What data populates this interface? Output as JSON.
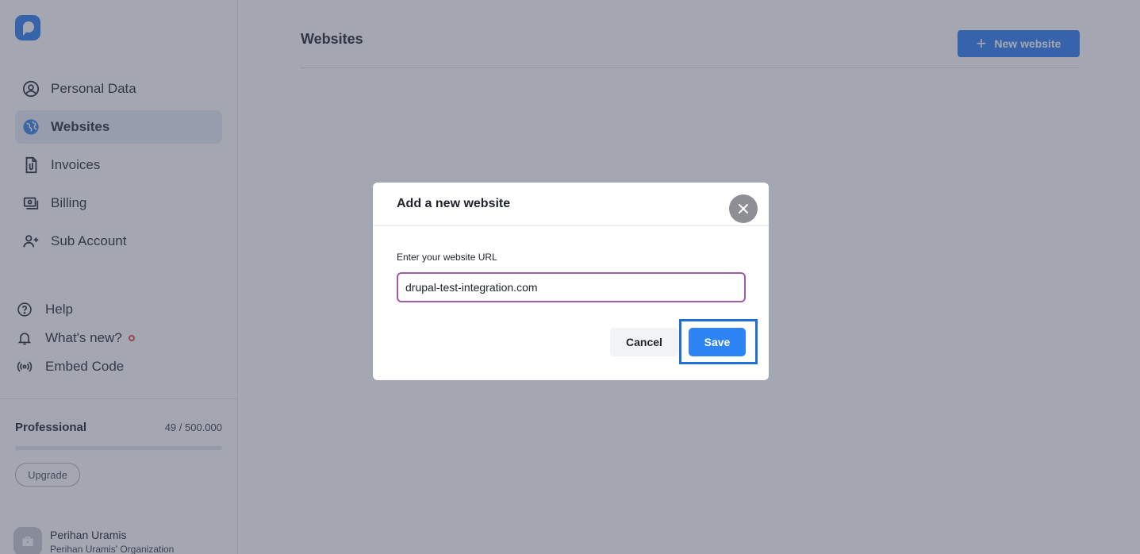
{
  "sidebar": {
    "nav": [
      {
        "label": "Personal Data",
        "icon": "user-circle-icon",
        "active": false
      },
      {
        "label": "Websites",
        "icon": "globe-icon",
        "active": true
      },
      {
        "label": "Invoices",
        "icon": "invoice-icon",
        "active": false
      },
      {
        "label": "Billing",
        "icon": "billing-icon",
        "active": false
      },
      {
        "label": "Sub Account",
        "icon": "add-user-icon",
        "active": false
      }
    ],
    "links": [
      {
        "label": "Help",
        "icon": "help-icon"
      },
      {
        "label": "What's new?",
        "icon": "bell-icon"
      },
      {
        "label": "Embed Code",
        "icon": "broadcast-icon"
      }
    ],
    "plan": {
      "name": "Professional",
      "usage": "49 / 500.000",
      "usage_fraction": 9.8e-05,
      "upgrade_label": "Upgrade"
    },
    "user": {
      "name": "Perihan Uramis",
      "organization": "Perihan Uramis' Organization"
    }
  },
  "main": {
    "title": "Websites",
    "new_button_label": "New website"
  },
  "modal": {
    "title": "Add a new website",
    "field_label": "Enter your website URL",
    "url_value": "drupal-test-integration.com",
    "cancel_label": "Cancel",
    "save_label": "Save"
  },
  "colors": {
    "accent": "#2d84f5",
    "active_nav_bg": "#e9eef7",
    "input_border": "#a05aa8",
    "highlight_border": "#1e6fd9",
    "notification_dot": "#e0484a"
  }
}
